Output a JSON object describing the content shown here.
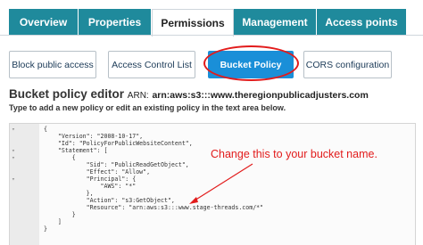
{
  "tabs": [
    {
      "label": "Overview"
    },
    {
      "label": "Properties"
    },
    {
      "label": "Permissions"
    },
    {
      "label": "Management"
    },
    {
      "label": "Access points"
    }
  ],
  "subtabs": [
    {
      "label": "Block public access"
    },
    {
      "label": "Access Control List"
    },
    {
      "label": "Bucket Policy"
    },
    {
      "label": "CORS configuration"
    }
  ],
  "editor": {
    "title": "Bucket policy editor",
    "arn_label": "ARN:",
    "arn_value": "arn:aws:s3:::www.theregionpublicadjusters.com",
    "subtitle": "Type to add a new policy or edit an existing policy in the text area below.",
    "code_lines": [
      "{",
      "    \"Version\": \"2008-10-17\",",
      "    \"Id\": \"PolicyForPublicWebsiteContent\",",
      "    \"Statement\": [",
      "        {",
      "            \"Sid\": \"PublicReadGetObject\",",
      "            \"Effect\": \"Allow\",",
      "            \"Principal\": {",
      "                \"AWS\": \"*\"",
      "            },",
      "            \"Action\": \"s3:GetObject\",",
      "            \"Resource\": \"arn:aws:s3:::www.stage-threads.com/*\"",
      "        }",
      "    ]",
      "}"
    ]
  },
  "annotation": {
    "text": "Change this to your bucket name.",
    "color": "#e21b1b"
  },
  "colors": {
    "tab_bg": "#1f8a9c",
    "active_button": "#1a8fd8",
    "highlight": "#e21b1b"
  }
}
